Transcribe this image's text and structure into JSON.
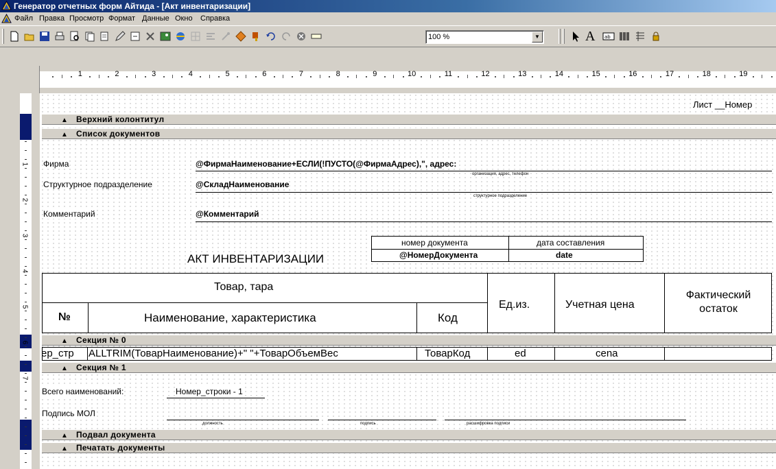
{
  "window": {
    "title": "Генератор отчетных форм Айтида - [Акт инвентаризации]"
  },
  "menu": [
    "Файл",
    "Правка",
    "Просмотр",
    "Формат",
    "Данные",
    "Окно",
    "Справка"
  ],
  "toolbar": {
    "zoom": "100 %",
    "icons": [
      "new-icon",
      "open-icon",
      "save-icon",
      "print-icon",
      "preview-icon",
      "copy-page-icon",
      "paste-page-icon",
      "pencil-icon",
      "page-icon",
      "delete-icon",
      "image-icon",
      "browser-icon",
      "grid-icon",
      "align-icon",
      "magic-icon",
      "diamond-icon",
      "paint-icon",
      "undo-icon",
      "redo-icon",
      "stop-icon",
      "ruler-icon"
    ],
    "tools": [
      "pointer-icon",
      "text-tool-icon",
      "field-tool-icon",
      "barcode-tool-icon",
      "list-tool-icon",
      "lock-icon"
    ]
  },
  "ruler": {
    "numbers": [
      "1",
      "2",
      "3",
      "4",
      "5",
      "6",
      "7",
      "8",
      "9",
      "10",
      "11",
      "12",
      "13",
      "14",
      "15",
      "16",
      "17",
      "18",
      "19"
    ],
    "v_numbers": [
      "1",
      "2",
      "3",
      "4",
      "5",
      "6",
      "7"
    ]
  },
  "report": {
    "sheet": "Лист __Номер",
    "bands": {
      "header": "Верхний колонтитул",
      "docs": "Список документов",
      "section0": "Секция № 0",
      "section1": "Секция № 1",
      "footer": "Подвал документа",
      "print": "Печатать документы"
    },
    "firm_label": "Фирма",
    "firm_expr": "@ФирмаНаименование+ЕСЛИ(!ПУСТО(@ФирмаАдрес),\", адрес:",
    "firm_hint": "организация, адрес, телефон",
    "dept_label": "Структурное подразделение",
    "dept_expr": "@СкладНаименование",
    "dept_hint": "структурное подразделение",
    "comment_label": "Комментарий",
    "comment_expr": "@Комментарий",
    "doc_title": "АКТ ИНВЕНТАРИЗАЦИИ",
    "docnum_label": "номер документа",
    "docnum_expr": "@НомерДокумента",
    "date_label": "дата составления",
    "date_expr": "date",
    "table": {
      "goods": "Товар, тара",
      "num": "№",
      "name": "Наименование, характеристика",
      "code": "Код",
      "unit": "Ед.из.",
      "price": "Учетная цена",
      "actual": "Фактический остаток"
    },
    "row": {
      "num": "ер_стр",
      "name": "ALLTRIM(ТоварНаименование)+\" \"+ТоварОбъемВес",
      "code": "ТоварКод",
      "unit": "ed",
      "price": "cena"
    },
    "total_label": "Всего наименований:",
    "total_expr": "Номер_строки - 1",
    "sign_label": "Подпись МОЛ",
    "sign_pos": "должность",
    "sign_sig": "подпись",
    "sign_name": "расшифровка подписи"
  }
}
